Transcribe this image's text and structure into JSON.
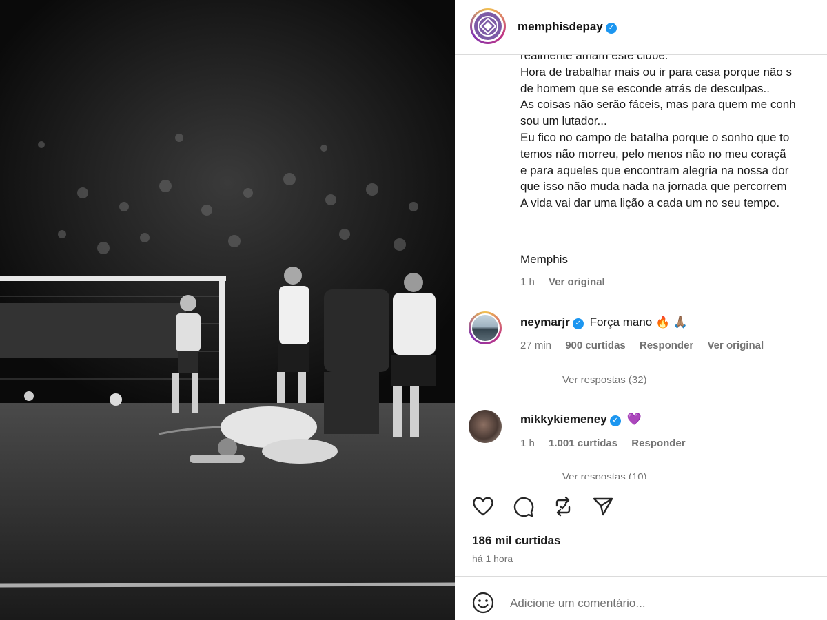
{
  "post": {
    "username": "memphisdepay",
    "caption_lines": [
      "realmente amam este clube.",
      "Hora de trabalhar mais ou ir para casa porque não s",
      "de homem que se esconde atrás de desculpas..",
      "As coisas não serão fáceis, mas para quem me conh",
      "sou um lutador...",
      "Eu fico no campo de batalha porque o sonho que to",
      "temos não morreu, pelo menos não no meu coraçã",
      "e para aqueles que encontram alegria na nossa dor",
      "que isso não muda nada na jornada que percorrem",
      "A vida vai dar uma lição a cada um no seu tempo."
    ],
    "signoff": "Memphis",
    "age": "1 h",
    "see_original": "Ver original",
    "likes": "186 mil curtidas",
    "time": "há 1 hora"
  },
  "comments": [
    {
      "username": "neymarjr",
      "text": "Força mano 🔥 🙏🏽",
      "age": "27 min",
      "likes": "900 curtidas",
      "reply": "Responder",
      "see_original": "Ver original",
      "view_replies": "Ver respostas (32)"
    },
    {
      "username": "mikkykiemeney",
      "text": "💜",
      "age": "1 h",
      "likes": "1.001 curtidas",
      "reply": "Responder",
      "view_replies": "Ver respostas (10)"
    }
  ],
  "add_comment": {
    "placeholder": "Adicione um comentário..."
  },
  "icons": {
    "verified": "verified-badge-icon",
    "like": "heart-icon",
    "comment": "comment-icon",
    "repost": "repost-icon",
    "share": "send-icon",
    "emoji": "emoji-icon"
  },
  "colors": {
    "verified": "#1c96f0",
    "muted_text": "#737373",
    "divider": "#dbdbdb"
  }
}
